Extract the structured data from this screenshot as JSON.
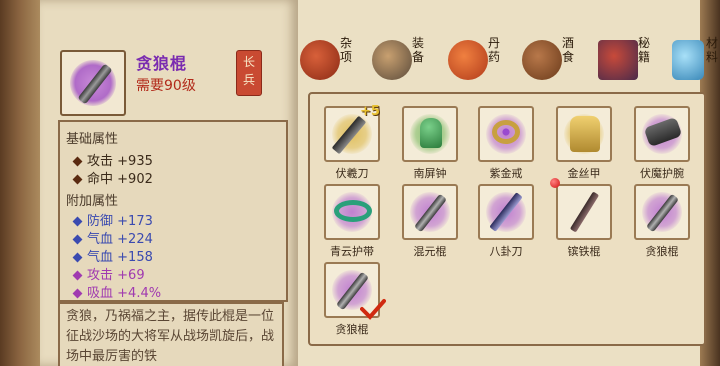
{
  "item": {
    "name": "贪狼棍",
    "requirement": "需要90级",
    "type_badge": "长兵"
  },
  "stats": {
    "base_title": "基础属性",
    "base": [
      {
        "name": "攻击",
        "value": "+935"
      },
      {
        "name": "命中",
        "value": "+902"
      }
    ],
    "extra_title": "附加属性",
    "extra": [
      {
        "name": "防御",
        "value": "+173",
        "color": "#3a4ab0"
      },
      {
        "name": "气血",
        "value": "+224",
        "color": "#3a4ab0"
      },
      {
        "name": "气血",
        "value": "+158",
        "color": "#3a4ab0"
      },
      {
        "name": "攻击",
        "value": "+69",
        "color": "#a03ab0"
      },
      {
        "name": "吸血",
        "value": "+4.4%",
        "color": "#a03ab0"
      }
    ],
    "description": "贪狼，乃祸福之主，据传此棍是一位征战沙场的大将军从战场凯旋后，战场中最厉害的铁"
  },
  "tabs": [
    {
      "label": "杂项",
      "icon": "jar-icon",
      "active": false
    },
    {
      "label": "装备",
      "icon": "equipment-icon",
      "active": true
    },
    {
      "label": "丹药",
      "icon": "pill-icon",
      "active": false
    },
    {
      "label": "酒食",
      "icon": "food-icon",
      "active": false
    },
    {
      "label": "秘籍",
      "icon": "book-icon",
      "active": false
    },
    {
      "label": "材料",
      "icon": "crystal-icon",
      "active": false
    }
  ],
  "inventory": [
    {
      "label": "伏羲刀",
      "icon": "blade-icon",
      "glow": "#e0c060",
      "badge": "+5"
    },
    {
      "label": "南屏钟",
      "icon": "bell-icon",
      "glow": "#8ac070",
      "badge": ""
    },
    {
      "label": "紫金戒",
      "icon": "ring-icon",
      "glow": "#c080d0",
      "badge": ""
    },
    {
      "label": "金丝甲",
      "icon": "armor-icon",
      "glow": "#e0c060",
      "badge": ""
    },
    {
      "label": "伏魔护腕",
      "icon": "bracer-icon",
      "glow": "#c080d0",
      "badge": ""
    },
    {
      "label": "青云护带",
      "icon": "belt-icon",
      "glow": "#c080d0",
      "badge": ""
    },
    {
      "label": "混元棍",
      "icon": "staff-icon",
      "glow": "#c080d0",
      "badge": ""
    },
    {
      "label": "八卦刀",
      "icon": "sword-icon",
      "glow": "#c080d0",
      "badge": ""
    },
    {
      "label": "镔铁棍",
      "icon": "iron-staff-icon",
      "glow": "",
      "badge": "",
      "new": true
    },
    {
      "label": "贪狼棍",
      "icon": "staff-icon",
      "glow": "#c080d0",
      "badge": ""
    },
    {
      "label": "贪狼棍",
      "icon": "staff-icon",
      "glow": "#c080d0",
      "badge": "",
      "equipped": true
    }
  ]
}
